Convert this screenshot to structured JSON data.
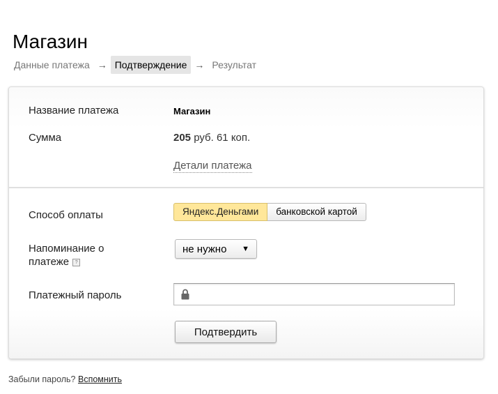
{
  "page": {
    "title": "Магазин"
  },
  "steps": [
    {
      "label": "Данные платежа"
    },
    {
      "label": "Подтверждение"
    },
    {
      "label": "Результат"
    }
  ],
  "steps_arrow": "→",
  "payment": {
    "name_label": "Название платежа",
    "name_value": "Магазин",
    "amount_label": "Сумма",
    "amount_main": "205",
    "amount_rest": " руб. 61 коп.",
    "details_link": "Детали платежа"
  },
  "method": {
    "label": "Способ оплаты",
    "options": [
      "Яндекс.Деньгами",
      "банковской картой"
    ],
    "selected": "Яндекс.Деньгами"
  },
  "reminder": {
    "label_line1": "Напоминание о",
    "label_line2": "платеже",
    "help": "?",
    "value": "не нужно",
    "caret": "▼"
  },
  "password": {
    "label": "Платежный пароль",
    "value": "",
    "placeholder": ""
  },
  "confirm": {
    "label": "Подтвердить"
  },
  "footer": {
    "text": "Забыли пароль? ",
    "link": "Вспомнить"
  },
  "colors": {
    "selected_option_bg": "#ffe79a",
    "active_step_bg": "#e5e5e5"
  }
}
